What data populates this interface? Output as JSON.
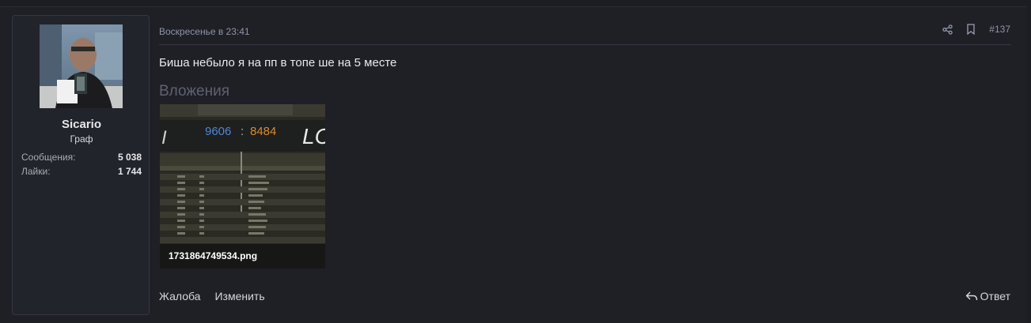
{
  "user": {
    "name": "Sicario",
    "title": "Граф",
    "online": true,
    "stats": [
      {
        "label": "Сообщения:",
        "value": "5 038"
      },
      {
        "label": "Лайки:",
        "value": "1 744"
      }
    ]
  },
  "post": {
    "date": "Воскресенье в 23:41",
    "number": "#137",
    "message": "Биша небыло я на пп в топе ше на 5 месте"
  },
  "attachments": {
    "title": "Вложения",
    "items": [
      {
        "filename": "1731864749534.png",
        "score_blue": "9606",
        "score_sep": ":",
        "score_orange": "8484"
      }
    ]
  },
  "actions": {
    "report": "Жалоба",
    "edit": "Изменить",
    "reply": "Ответ"
  },
  "icons": {
    "share": "share-icon",
    "bookmark": "bookmark-icon",
    "reply": "reply-icon",
    "online": "online-status-icon"
  },
  "colors": {
    "background": "#1f2026",
    "panel": "#22242b",
    "online": "#3c8d2c",
    "muted": "#8e94a6"
  }
}
